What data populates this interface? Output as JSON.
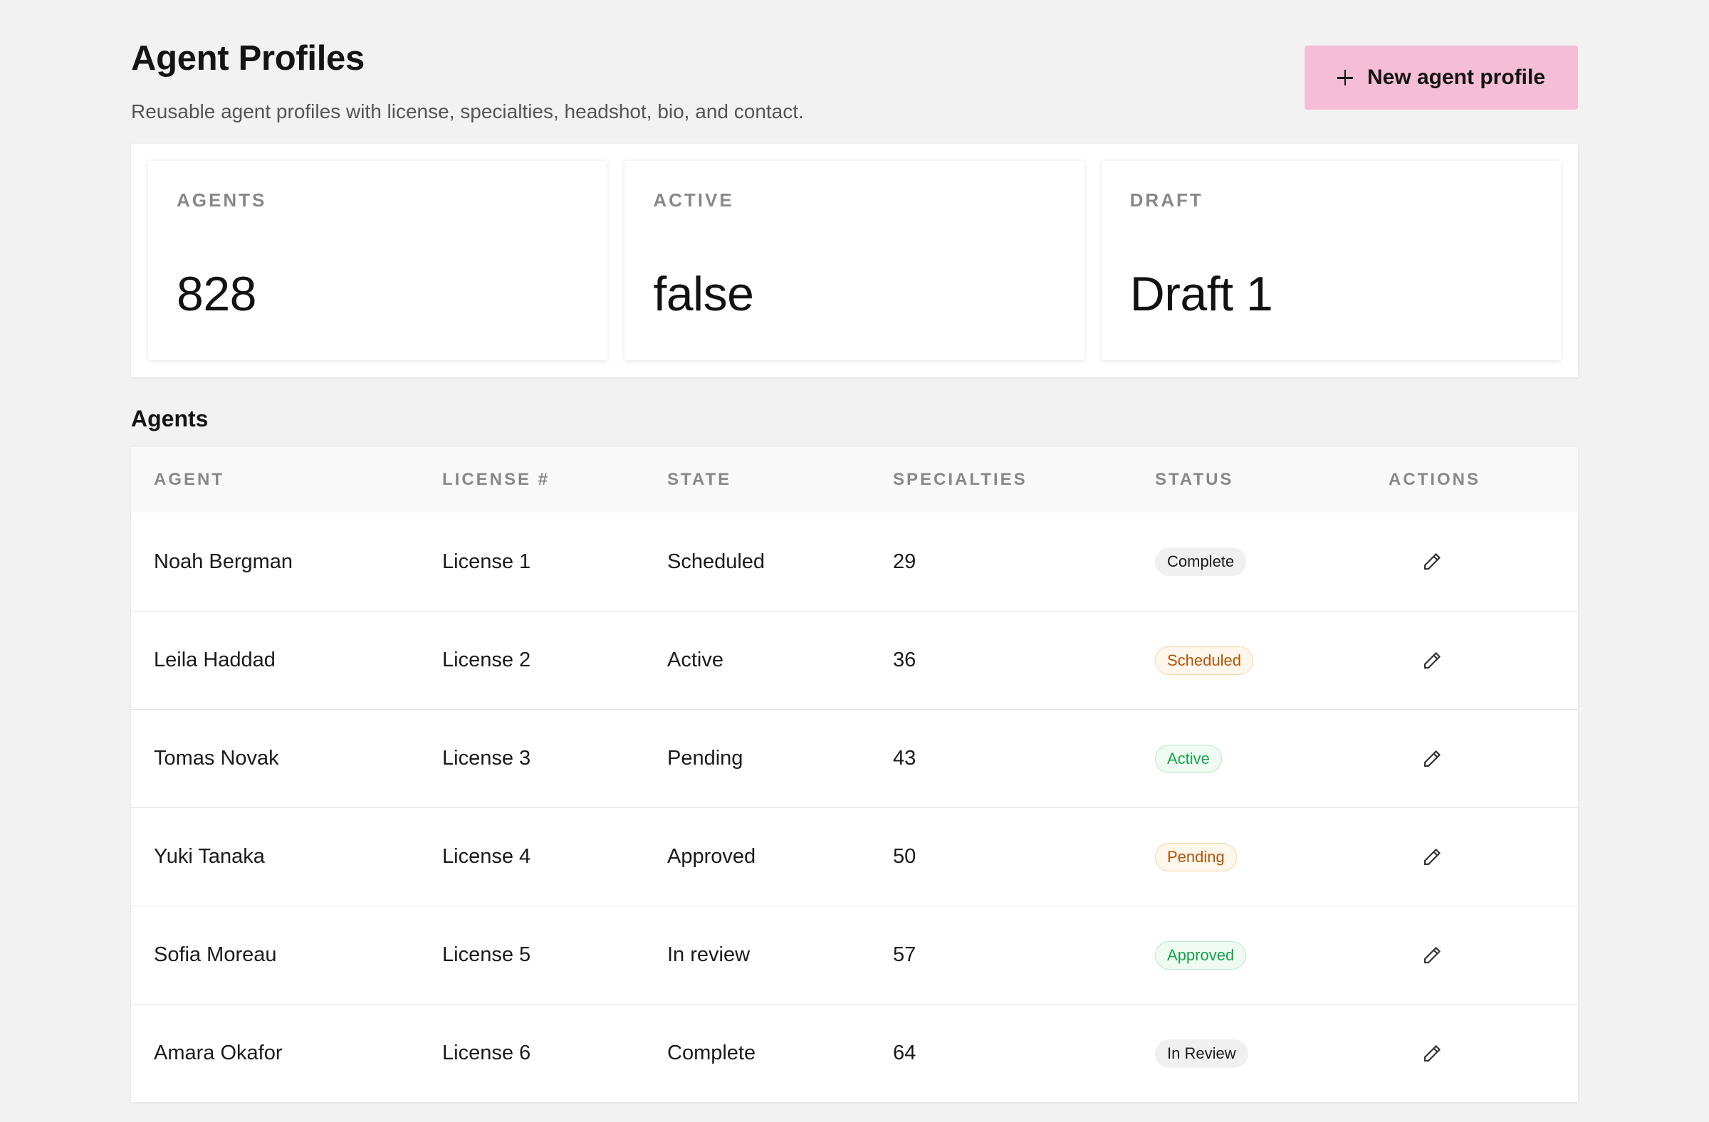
{
  "header": {
    "title": "Agent Profiles",
    "subtitle": "Reusable agent profiles with license, specialties, headshot, bio, and contact.",
    "new_button_label": "New agent profile"
  },
  "stats": [
    {
      "label": "AGENTS",
      "value": "828"
    },
    {
      "label": "ACTIVE",
      "value": "false"
    },
    {
      "label": "DRAFT",
      "value": "Draft 1"
    }
  ],
  "section_title": "Agents",
  "table": {
    "columns": [
      "AGENT",
      "LICENSE #",
      "STATE",
      "SPECIALTIES",
      "STATUS",
      "ACTIONS"
    ],
    "rows": [
      {
        "agent": "Noah Bergman",
        "license": "License 1",
        "state": "Scheduled",
        "specialties": "29",
        "status": "Complete"
      },
      {
        "agent": "Leila Haddad",
        "license": "License 2",
        "state": "Active",
        "specialties": "36",
        "status": "Scheduled"
      },
      {
        "agent": "Tomas Novak",
        "license": "License 3",
        "state": "Pending",
        "specialties": "43",
        "status": "Active"
      },
      {
        "agent": "Yuki Tanaka",
        "license": "License 4",
        "state": "Approved",
        "specialties": "50",
        "status": "Pending"
      },
      {
        "agent": "Sofia Moreau",
        "license": "License 5",
        "state": "In review",
        "specialties": "57",
        "status": "Approved"
      },
      {
        "agent": "Amara Okafor",
        "license": "License 6",
        "state": "Complete",
        "specialties": "64",
        "status": "In Review"
      }
    ]
  },
  "colors": {
    "accent_button": "#f5bed6",
    "status_neutral_bg": "#f0f0f0",
    "status_neutral_text": "#1a1a1a",
    "status_warning_bg": "#fff7ec",
    "status_warning_border": "#f6d3a8",
    "status_warning_text": "#b45309",
    "status_success_bg": "#effaf2",
    "status_success_border": "#bde6c9",
    "status_success_text": "#16a34a"
  },
  "icons": {
    "new_button": "plus-icon",
    "row_action": "pencil-edit-icon"
  }
}
